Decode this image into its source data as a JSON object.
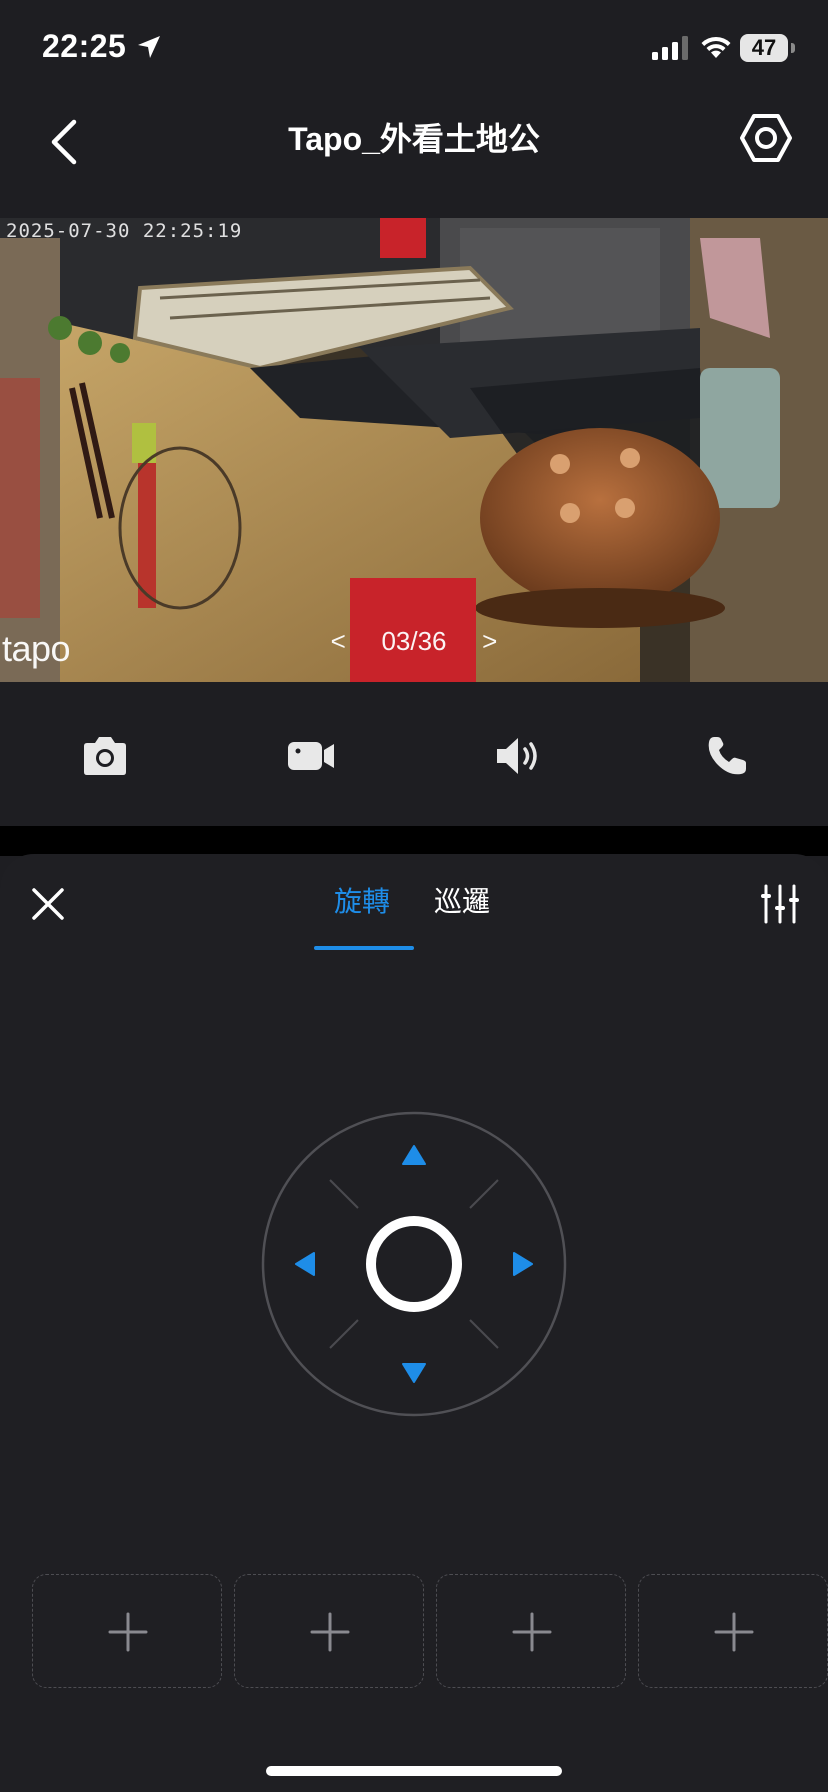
{
  "status_bar": {
    "time": "22:25",
    "battery": "47",
    "icons": [
      "location-arrow-icon",
      "cellular-signal-icon",
      "wifi-icon",
      "battery-icon"
    ]
  },
  "nav": {
    "title": "Tapo_外看土地公",
    "icons": [
      "back-chevron-icon",
      "settings-hexagon-icon"
    ]
  },
  "video": {
    "timestamp": "2025-07-30 22:25:19",
    "brand": "tapo",
    "pager": "03/36",
    "pager_prev": "<",
    "pager_next": ">"
  },
  "controls": {
    "icons": [
      "camera-icon",
      "video-record-icon",
      "speaker-icon",
      "phone-icon"
    ]
  },
  "sheet": {
    "tabs": [
      {
        "label": "旋轉",
        "active": true
      },
      {
        "label": "巡邏",
        "active": false
      }
    ],
    "icons": [
      "close-icon",
      "adjust-sliders-icon"
    ],
    "joystick_icons": [
      "arrow-up-icon",
      "arrow-down-icon",
      "arrow-left-icon",
      "arrow-right-icon",
      "center-ring-icon"
    ],
    "presets": [
      "add-icon",
      "add-icon",
      "add-icon",
      "add-icon"
    ]
  },
  "colors": {
    "accent": "#1e8de8",
    "background": "#1e1e22",
    "sheet": "#1f1f23"
  }
}
